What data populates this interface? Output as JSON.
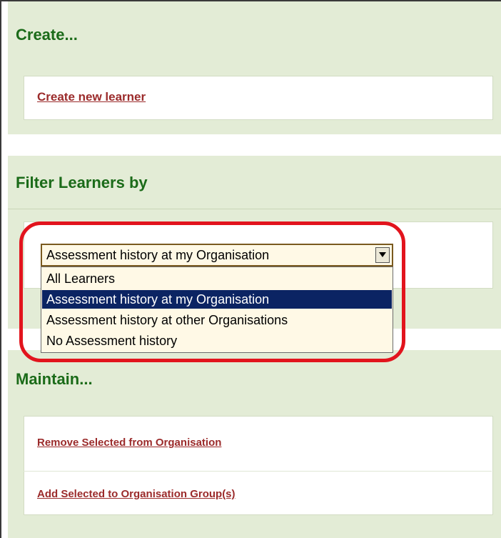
{
  "create_section": {
    "title": "Create...",
    "links": [
      "Create new learner"
    ]
  },
  "filter_section": {
    "title": "Filter Learners by",
    "select": {
      "selected_value": "Assessment history at my Organisation",
      "options": [
        "All Learners",
        "Assessment history at my Organisation",
        "Assessment history at other Organisations",
        "No Assessment history"
      ],
      "highlighted_index": 1
    }
  },
  "maintain_section": {
    "title": "Maintain...",
    "links": [
      "Remove Selected from Organisation",
      "Add Selected to Organisation Group(s)"
    ]
  },
  "colors": {
    "section_title": "#1b6b19",
    "panel_bg": "#e3ecd6",
    "link": "#9b2b2b",
    "highlight_ring": "#e2141d",
    "selected_option_bg": "#0b2463"
  }
}
